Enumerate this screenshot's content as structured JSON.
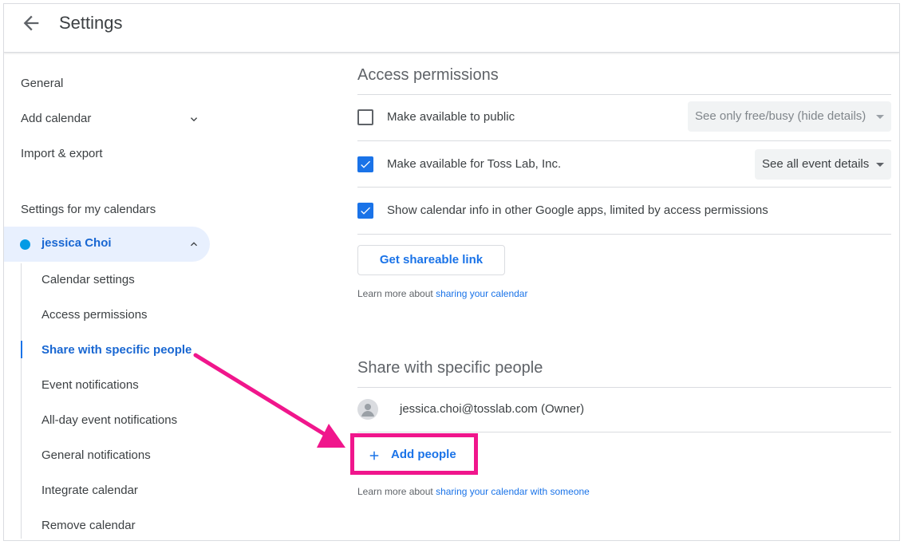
{
  "header": {
    "title": "Settings",
    "back_icon": "arrow-back-icon"
  },
  "sidebar": {
    "items": [
      {
        "label": "General"
      },
      {
        "label": "Add calendar"
      },
      {
        "label": "Import & export"
      }
    ],
    "section_title": "Settings for my calendars",
    "calendar": {
      "name": "jessica Choi",
      "color": "#039be5"
    },
    "sub_items": [
      {
        "label": "Calendar settings"
      },
      {
        "label": "Access permissions"
      },
      {
        "label": "Share with specific people",
        "active": true
      },
      {
        "label": "Event notifications"
      },
      {
        "label": "All-day event notifications"
      },
      {
        "label": "General notifications"
      },
      {
        "label": "Integrate calendar"
      },
      {
        "label": "Remove calendar"
      }
    ]
  },
  "access_permissions": {
    "title": "Access permissions",
    "rows": [
      {
        "label": "Make available to public",
        "checked": false,
        "dropdown": "See only free/busy (hide details)",
        "dropdown_disabled": true
      },
      {
        "label": "Make available for Toss Lab, Inc.",
        "checked": true,
        "dropdown": "See all event details",
        "dropdown_disabled": false
      },
      {
        "label": "Show calendar info in other Google apps, limited by access permissions",
        "checked": true
      }
    ],
    "shareable_link_button": "Get shareable link",
    "learn_prefix": "Learn more about ",
    "learn_link": "sharing your calendar"
  },
  "share_specific": {
    "title": "Share with specific people",
    "owner": "jessica.choi@tosslab.com (Owner)",
    "add_people_button": "Add people",
    "learn_prefix": "Learn more about ",
    "learn_link": "sharing your calendar with someone"
  },
  "colors": {
    "accent": "#1a73e8",
    "annotation": "#f0168c",
    "active_bg": "#e8f0fe"
  }
}
